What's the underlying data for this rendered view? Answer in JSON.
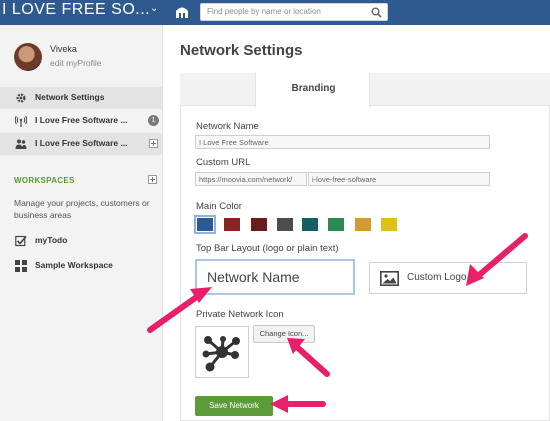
{
  "topbar": {
    "brand": "I LOVE FREE SO...",
    "brand_caret": "⌄",
    "search_placeholder": "Find people by name or location",
    "color": "#2e5a8f"
  },
  "sidebar": {
    "user": {
      "name": "Viveka",
      "sub": "edit myProfile"
    },
    "items": [
      {
        "label": "Network Settings",
        "icon": "gear-icon"
      },
      {
        "label": "I Love Free Software ...",
        "icon": "broadcast-icon",
        "badge": "1"
      },
      {
        "label": "I Love Free Software ...",
        "icon": "people-icon"
      }
    ],
    "workspaces_heading": "WORKSPACES",
    "workspaces_desc": "Manage your projects, customers or business areas",
    "workspaces": [
      {
        "label": "myTodo",
        "icon": "checkbox-icon"
      },
      {
        "label": "Sample Workspace",
        "icon": "grid-icon"
      }
    ]
  },
  "main": {
    "title": "Network Settings",
    "tab": "Branding",
    "network_name_label": "Network Name",
    "network_name_value": "I Love Free Software",
    "custom_url_label": "Custom URL",
    "custom_url_prefix": "https://moovia.com/network/",
    "custom_url_value": "i-love-free-software",
    "main_color_label": "Main Color",
    "colors": [
      "#2d5a93",
      "#8b2326",
      "#6b1a1d",
      "#4d4d4d",
      "#165e63",
      "#2d8a4f",
      "#d59a2e",
      "#dbc213"
    ],
    "selected_color": "#2d5a93",
    "top_bar_layout_label": "Top Bar Layout (logo or plain text)",
    "layout_text_option": "Network Name",
    "layout_logo_option": "Custom Logo",
    "private_icon_label": "Private Network Icon",
    "change_icon_button": "Change Icon...",
    "save_button": "Save Network",
    "save_color": "#5c9a3a"
  }
}
